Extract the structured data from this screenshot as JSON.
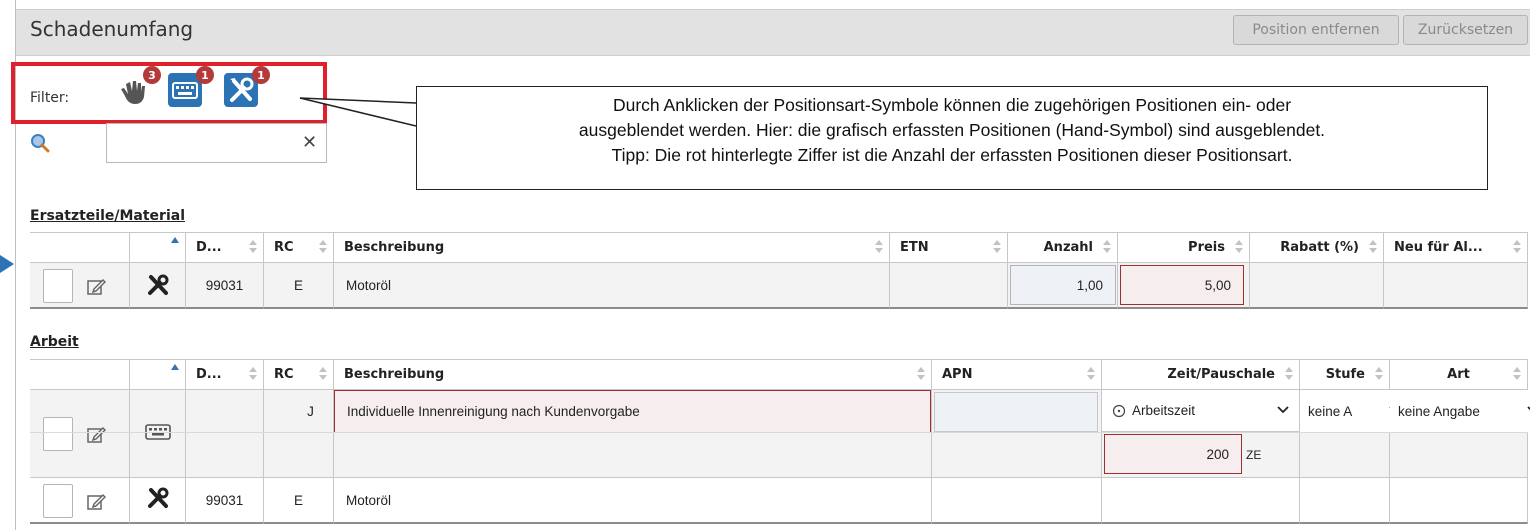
{
  "header": {
    "title": "Schadenumfang",
    "remove_button": "Position entfernen",
    "reset_button": "Zurücksetzen"
  },
  "filter": {
    "label": "Filter:",
    "items": [
      {
        "icon": "hand-pointer-icon",
        "count": "3"
      },
      {
        "icon": "keyboard-icon",
        "count": "1"
      },
      {
        "icon": "tools-icon",
        "count": "1"
      }
    ]
  },
  "search": {
    "value": "",
    "clear_icon": "✕"
  },
  "callout": {
    "line1": "Durch Anklicken der Positionsart-Symbole können die zugehörigen Positionen ein- oder",
    "line2": "ausgeblendet werden. Hier: die grafisch erfassten Positionen (Hand-Symbol) sind ausgeblendet.",
    "line3": "Tipp: Die rot hinterlegte Ziffer ist die Anzahl der erfassten Positionen dieser Positionsart."
  },
  "parts": {
    "title": "Ersatzteile/Material",
    "columns": [
      "D...",
      "RC",
      "Beschreibung",
      "ETN",
      "Anzahl",
      "Preis",
      "Rabatt (%)",
      "Neu für Al..."
    ],
    "rows": [
      {
        "type_icon": "tools-icon",
        "d": "99031",
        "rc": "E",
        "desc": "Motoröl",
        "etn": "",
        "anzahl": "1,00",
        "preis": "5,00",
        "rabatt": "",
        "neu": ""
      }
    ]
  },
  "labor": {
    "title": "Arbeit",
    "columns": [
      "D...",
      "RC",
      "Beschreibung",
      "APN",
      "Zeit/Pauschale",
      "Stufe",
      "Art"
    ],
    "rows": [
      {
        "type_icon": "keyboard-icon",
        "d": "",
        "rc": "J",
        "desc": "Individuelle Innenreinigung nach Kundenvorgabe",
        "apn": "",
        "zeit_select": "Arbeitszeit",
        "zeit_value": "200",
        "zeit_unit": "ZE",
        "stufe": "keine A",
        "art": "keine Angabe"
      },
      {
        "type_icon": "tools-icon",
        "d": "99031",
        "rc": "E",
        "desc": "Motoröl",
        "apn": ""
      }
    ]
  },
  "colors": {
    "accent_blue": "#2c73b6",
    "badge_red": "#b23a3a",
    "highlight_red": "#e0202a"
  }
}
